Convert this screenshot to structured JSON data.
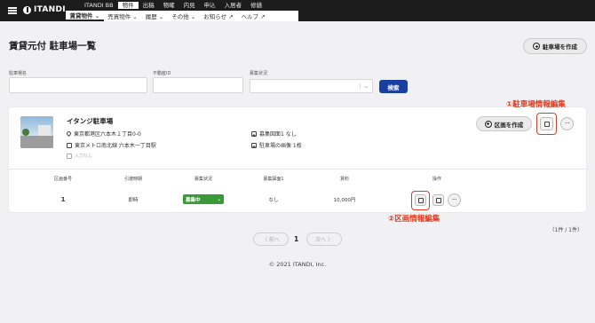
{
  "header": {
    "logo": "ITANDI",
    "top_nav": [
      "ITANDI BB",
      "物件",
      "出稿",
      "物確",
      "内見",
      "申込",
      "入居者",
      "修繕"
    ],
    "sub_nav": [
      "賃貸物件 ⌄",
      "売買物件 ⌄",
      "履歴 ⌄",
      "その他 ⌄",
      "お知らせ ↗",
      "ヘルプ ↗"
    ]
  },
  "page": {
    "title": "賃貸元付 駐車場一覧",
    "create_lot_button": "駐車場を作成"
  },
  "filters": {
    "lot_name_label": "駐車場名",
    "real_estate_id_label": "不動産ID",
    "recruit_status_label": "募集状況",
    "search_button": "検索"
  },
  "lot": {
    "name": "イタンジ駐車場",
    "address": "東京都港区六本木１丁目0-0",
    "station": "東京メトロ南北線 六本木一丁目駅",
    "note": "入力なし",
    "plan_image": "募集図面1 なし",
    "lot_images": "駐車場の画像 1枚",
    "create_section_button": "区画を作成"
  },
  "table": {
    "headers": [
      "区画番号",
      "引渡時期",
      "募集状況",
      "募集図面1",
      "賃料",
      "操作"
    ],
    "rows": [
      {
        "number": "1",
        "handover": "即時",
        "status": "募集中",
        "plan": "なし",
        "rent": "10,000円"
      }
    ]
  },
  "annotations": {
    "lot_edit": "①駐車場情報編集",
    "section_edit": "②区画情報編集",
    "color": "#e03a1f"
  },
  "pagination": {
    "prev": "〈 前へ",
    "next": "次へ 〉",
    "current": "1",
    "count": "（1件 / 1件）"
  },
  "footer": "© 2021 ITANDI, Inc.",
  "colors": {
    "search_button": "#1a3fa0",
    "status_badge": "#3a9a3a",
    "topbar": "#1c1c1c"
  }
}
